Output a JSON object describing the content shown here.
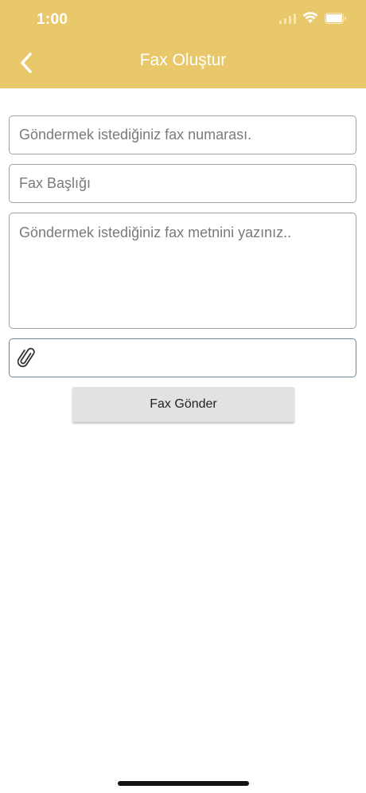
{
  "status_bar": {
    "time": "1:00",
    "icons": [
      "cellular-signal-icon",
      "wifi-icon",
      "battery-icon"
    ]
  },
  "header": {
    "title": "Fax Oluştur",
    "back_icon": "chevron-left-icon",
    "background_color": "#e8c86a",
    "text_color": "#ffffff"
  },
  "form": {
    "fax_number": {
      "value": "",
      "placeholder": "Göndermek istediğiniz fax numarası."
    },
    "fax_title": {
      "value": "",
      "placeholder": "Fax Başlığı"
    },
    "fax_body": {
      "value": "",
      "placeholder": "Göndermek istediğiniz fax metnini yazınız.."
    },
    "attachment": {
      "icon": "paperclip-icon",
      "value": ""
    },
    "send_button_label": "Fax Gönder",
    "button_color": "#e2e2e2"
  }
}
